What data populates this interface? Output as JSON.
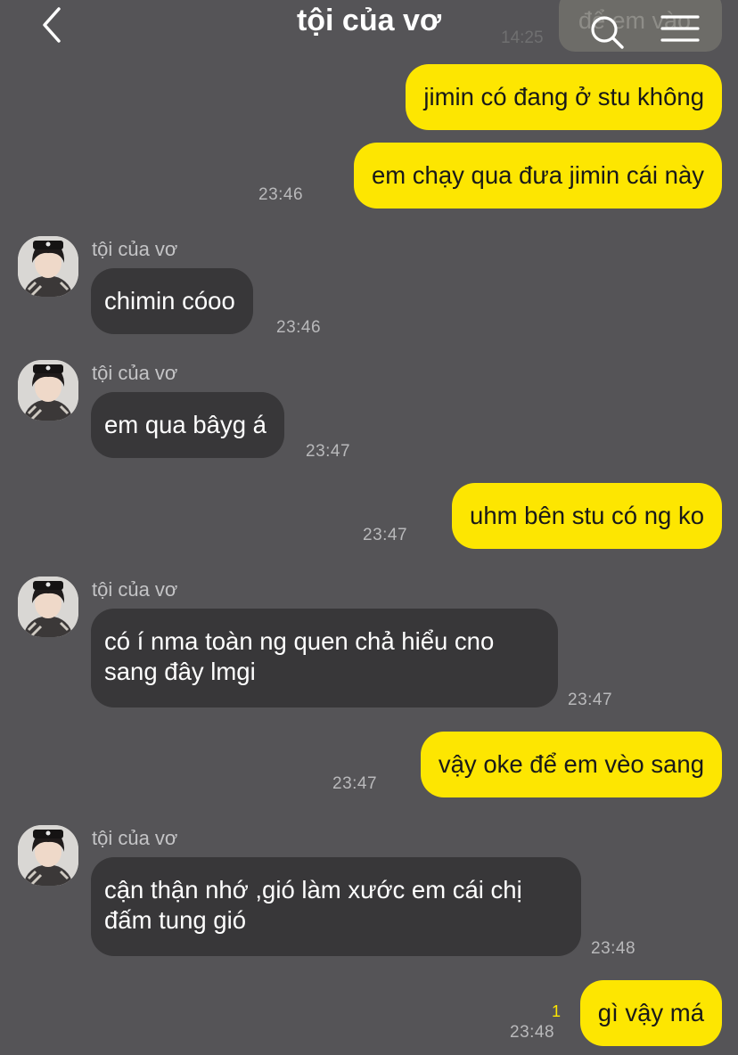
{
  "header": {
    "title": "tội của vơ",
    "ghost_bubble_text": "để em vào",
    "ghost_time": "14:25"
  },
  "messages": [
    {
      "text": "jimin có đang ở stu không"
    },
    {
      "text": "em chạy qua đưa jimin cái này",
      "time": "23:46"
    },
    {
      "sender": "tội của vơ",
      "text": "chimin cóoo",
      "time": "23:46"
    },
    {
      "sender": "tội của vơ",
      "text": "em qua bâyg á",
      "time": "23:47"
    },
    {
      "text": "uhm bên stu có ng ko",
      "time": "23:47"
    },
    {
      "sender": "tội của vơ",
      "line1": "có í nma toàn ng quen chả hiểu cno",
      "line2": "sang đây lmgi",
      "time": "23:47"
    },
    {
      "text": "vậy oke để em vèo sang",
      "time": "23:47"
    },
    {
      "sender": "tội của vơ",
      "line1": "cận thận nhớ ,gió làm xước em cái chị",
      "line2": "đấm tung gió",
      "time": "23:48"
    },
    {
      "text": "gì vậy má",
      "time": "23:48",
      "unread": "1"
    }
  ]
}
